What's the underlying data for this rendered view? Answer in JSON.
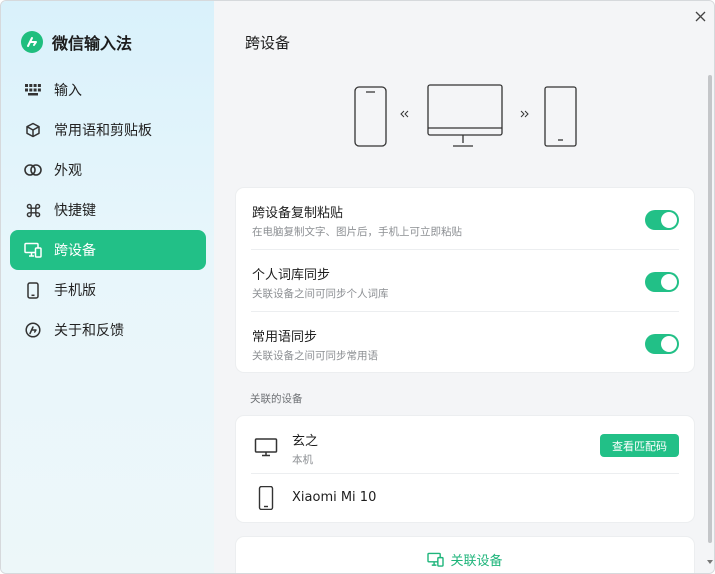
{
  "app": {
    "name": "微信输入法"
  },
  "sidebar": {
    "items": [
      {
        "label": "输入",
        "icon": "keyboard-icon"
      },
      {
        "label": "常用语和剪贴板",
        "icon": "cube-icon"
      },
      {
        "label": "外观",
        "icon": "circles-icon"
      },
      {
        "label": "快捷键",
        "icon": "command-icon"
      },
      {
        "label": "跨设备",
        "icon": "devices-icon",
        "active": true
      },
      {
        "label": "手机版",
        "icon": "phone-icon"
      },
      {
        "label": "关于和反馈",
        "icon": "about-logo-icon"
      }
    ]
  },
  "main": {
    "title": "跨设备",
    "settings": [
      {
        "title": "跨设备复制粘贴",
        "desc": "在电脑复制文字、图片后，手机上可立即粘贴",
        "enabled": true
      },
      {
        "title": "个人词库同步",
        "desc": "关联设备之间可同步个人词库",
        "enabled": true
      },
      {
        "title": "常用语同步",
        "desc": "关联设备之间可同步常用语",
        "enabled": true
      }
    ],
    "devices_label": "关联的设备",
    "devices": [
      {
        "name": "玄之",
        "sub": "本机",
        "icon": "monitor-icon",
        "action": "查看匹配码"
      },
      {
        "name": "Xiaomi Mi 10",
        "icon": "phone-icon"
      }
    ],
    "link_button": "关联设备"
  },
  "colors": {
    "accent": "#22c087",
    "sidebar_bg": "#dff3fa",
    "main_bg": "#f4f5f7"
  }
}
